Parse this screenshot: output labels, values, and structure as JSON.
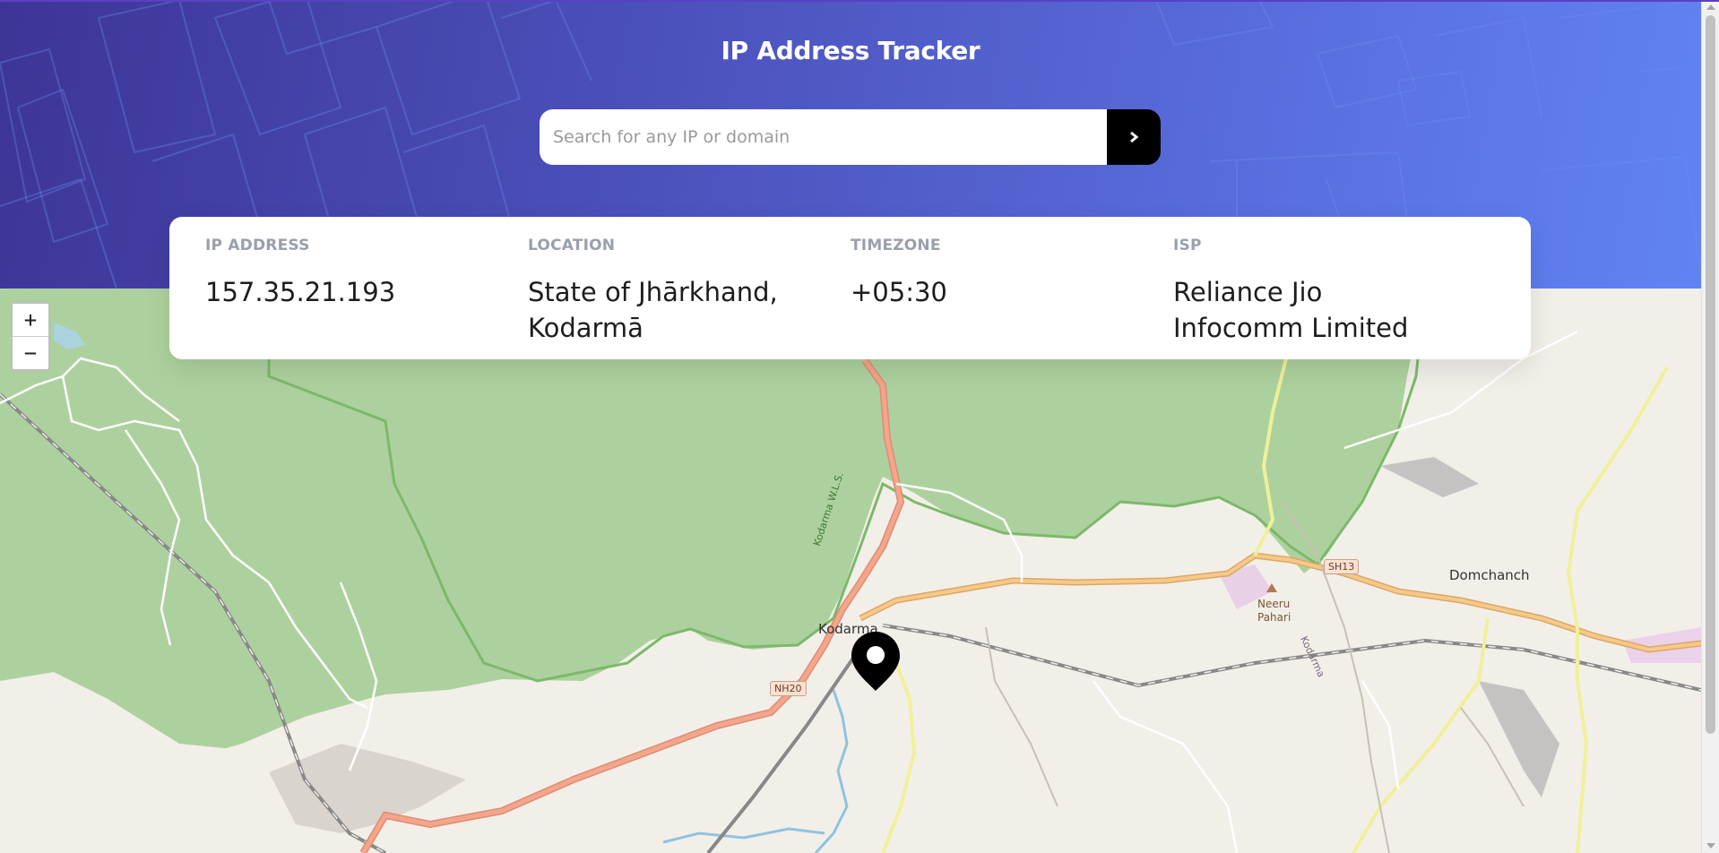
{
  "header": {
    "title": "IP Address Tracker",
    "search_placeholder": "Search for any IP or domain",
    "submit_icon": "chevron-right-icon"
  },
  "info": {
    "ip_address": {
      "label": "IP ADDRESS",
      "value": "157.35.21.193"
    },
    "location": {
      "label": "LOCATION",
      "value": "State of Jhārkhand, Kodarmā"
    },
    "timezone": {
      "label": "TIMEZONE",
      "value": "+05:30"
    },
    "isp": {
      "label": "ISP",
      "value": "Reliance Jio Infocomm Limited"
    }
  },
  "map": {
    "zoom_in": "+",
    "zoom_out": "−",
    "labels": {
      "kodarma": "Kodarma",
      "domchanch": "Domchanch",
      "neeru_pahari_1": "Neeru",
      "neeru_pahari_2": "Pahari",
      "kodarma_wls": "Kodarma W.L.S.",
      "kodarma_river": "Kodarma"
    },
    "shields": {
      "nh20": "NH20",
      "sh13": "SH13"
    },
    "marker_icon": "location-pin-icon",
    "colors": {
      "forest": "#add19e",
      "forest_border": "#7cb96a",
      "primary_road": "#f4a58a",
      "secondary_road": "#f7c887",
      "tertiary_road": "#f0f09a",
      "railway": "#888888",
      "water": "#8fc3e0",
      "land": "#f2efe9"
    }
  },
  "colors": {
    "header_gradient_start": "#3d3596",
    "header_gradient_end": "#6184f3",
    "button_bg": "#000000",
    "label_gray": "#9a9fad"
  }
}
